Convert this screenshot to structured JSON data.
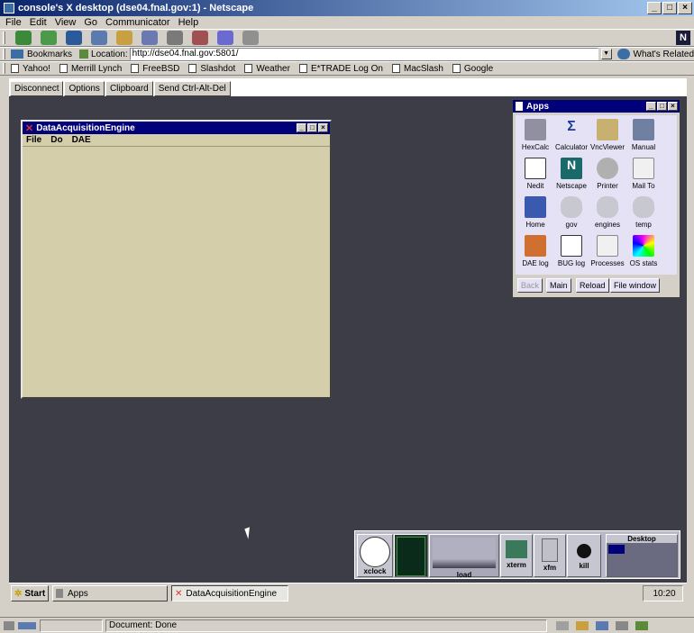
{
  "browser": {
    "title": "console's X desktop (dse04.fnal.gov:1) - Netscape",
    "menus": [
      "File",
      "Edit",
      "View",
      "Go",
      "Communicator",
      "Help"
    ],
    "bookmarks_label": "Bookmarks",
    "location_label": "Location:",
    "location_value": "http://dse04.fnal.gov:5801/",
    "whats_related": "What's Related",
    "personal_toolbar": [
      "Yahoo!",
      "Merrill Lynch",
      "FreeBSD",
      "Slashdot",
      "Weather",
      "E*TRADE Log On",
      "MacSlash",
      "Google"
    ],
    "status_text": "Document: Done"
  },
  "vnc": {
    "buttons": [
      "Disconnect",
      "Options",
      "Clipboard",
      "Send Ctrl-Alt-Del"
    ]
  },
  "dae_window": {
    "title": "DataAcquisitionEngine",
    "menus": [
      "File",
      "Do",
      "DAE"
    ]
  },
  "apps_window": {
    "title": "Apps",
    "apps": [
      "HexCalc",
      "Calculator",
      "VncViewer",
      "Manual",
      "Nedit",
      "Netscape",
      "Printer",
      "Mail To",
      "Home",
      "gov",
      "engines",
      "temp",
      "DAE log",
      "BUG log",
      "Processes",
      "OS stats"
    ],
    "buttons": [
      "Back",
      "Main",
      "Reload",
      "File window"
    ]
  },
  "panel": {
    "items": [
      "xclock",
      "load",
      "xterm",
      "xfm",
      "kill",
      "Desktop"
    ],
    "desktop_label": "Desktop"
  },
  "taskbar": {
    "start": "Start",
    "apps": "Apps",
    "dae": "DataAcquisitionEngine",
    "clock": "10:20"
  },
  "colors": {
    "titlebar": "#0a246a",
    "desktop": "#3d3d47",
    "dae_body": "#d4ceaa",
    "apps_body": "#e4e2f4"
  }
}
